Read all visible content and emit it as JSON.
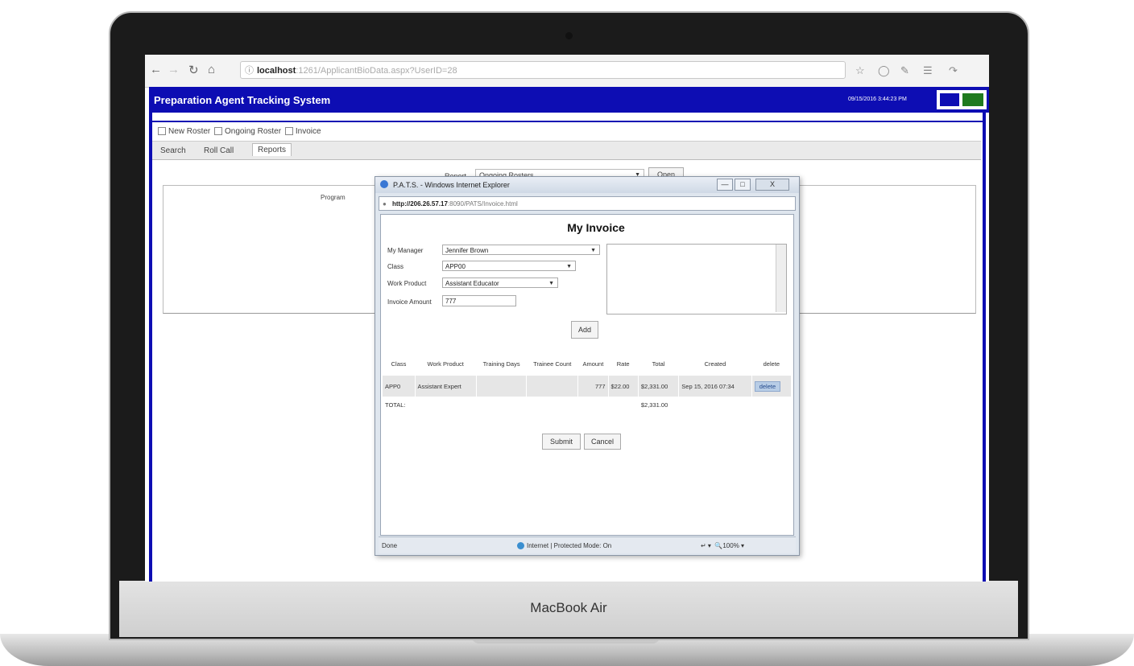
{
  "device": {
    "brand_label": "MacBook Air"
  },
  "browser": {
    "url_host": "localhost",
    "url_path": ":1261/ApplicantBioData.aspx?UserID=28",
    "icons": [
      "back-arrow-icon",
      "forward-arrow-icon",
      "refresh-icon",
      "home-icon",
      "info-icon",
      "star-icon",
      "shield-icon",
      "extension-icon",
      "menu-icon",
      "share-icon"
    ]
  },
  "app": {
    "title": "Preparation Agent Tracking System",
    "datetime": "09/15/2016 3:44:23 PM",
    "brand_colors": {
      "header": "#0d0db3",
      "logo_green": "#1f7a1f"
    },
    "checkbox_menu": [
      "New Roster",
      "Ongoing Roster",
      "Invoice"
    ],
    "tabs": [
      "Search",
      "Roll Call",
      "Reports"
    ],
    "active_tab": "Reports",
    "report_label": "Report",
    "report_value": "Ongoing Rosters",
    "open_label": "Open",
    "program_label": "Program"
  },
  "popup": {
    "title": "P.A.T.S. - Windows Internet Explorer",
    "url_bold": "http://206.26.57.17",
    "url_rest": ":8090/PATS/Invoice.html",
    "window_buttons": [
      "—",
      "□",
      "X"
    ],
    "heading": "My Invoice",
    "form": {
      "manager_label": "My Manager",
      "manager_value": "Jennifer Brown",
      "class_label": "Class",
      "class_value": "APP00",
      "workproduct_label": "Work Product",
      "workproduct_value": "Assistant Educator",
      "amount_label": "Invoice Amount",
      "amount_value": "777"
    },
    "add_label": "Add",
    "table": {
      "headers": [
        "Class",
        "Work Product",
        "Training Days",
        "Trainee Count",
        "Amount",
        "Rate",
        "Total",
        "Created",
        "delete"
      ],
      "rows": [
        {
          "class": "APP0",
          "work_product": "Assistant Expert",
          "training_days": "",
          "trainee_count": "",
          "amount": "777",
          "rate": "$22.00",
          "total": "$2,331.00",
          "created": "Sep 15, 2016 07:34",
          "delete": "delete"
        }
      ],
      "total_label": "TOTAL:",
      "total_value": "$2,331.00"
    },
    "submit_label": "Submit",
    "cancel_label": "Cancel",
    "status": {
      "done": "Done",
      "zone": "Internet | Protected Mode: On",
      "zoom": "100%"
    }
  }
}
